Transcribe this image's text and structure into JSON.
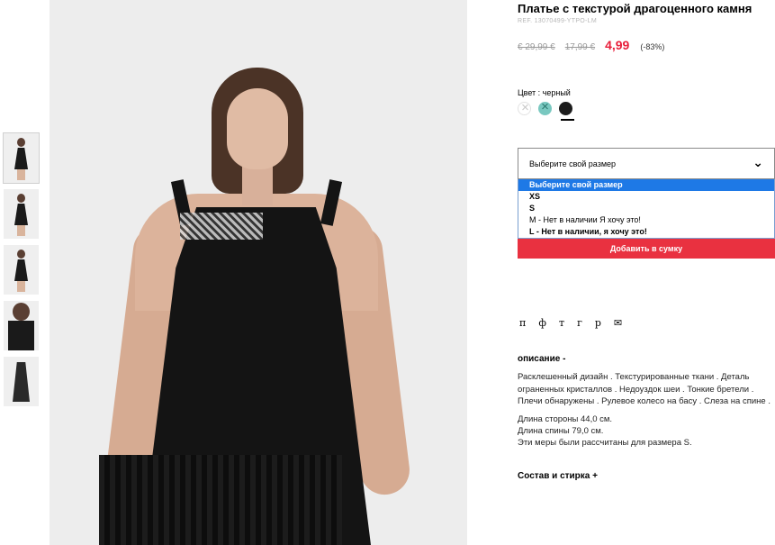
{
  "product": {
    "title": "Платье с текстурой драгоценного камня",
    "ref": "REF. 13070499-YTPO-LM",
    "price_original": "€ 29,99 €",
    "price_previous": "17,99 €",
    "price_current": "4,99",
    "discount": "(-83%)"
  },
  "color": {
    "label": "Цвет : черный",
    "swatches": [
      {
        "name": "white",
        "hex": "#ffffff",
        "available": false
      },
      {
        "name": "teal",
        "hex": "#79c8c0",
        "available": false
      },
      {
        "name": "black",
        "hex": "#1c1c1c",
        "available": true,
        "selected": true
      }
    ]
  },
  "size": {
    "placeholder": "Выберите свой размер",
    "options": [
      "Выберите свой размер",
      "XS",
      "S",
      "M - Нет в наличии Я хочу это!",
      "L - Нет в наличии, я хочу это!"
    ]
  },
  "add_to_bag": "Добавить в сумку",
  "share": [
    "п",
    "ф",
    "т",
    "г",
    "р",
    "✉"
  ],
  "description": {
    "heading": "описание -",
    "text": "Расклешенный дизайн . Текстурированные ткани . Деталь ограненных кристаллов . Недоуздок шеи . Тонкие бретели . Плечи обнаружены . Рулевое колесо на басу . Слеза на спине .",
    "side_length": "Длина стороны 44,0 см.",
    "back_length": "Длина спины 79,0 см.",
    "measured_note": "Эти меры были рассчитаны для размера S."
  },
  "composition": "Состав и стирка +",
  "colors": {
    "accent": "#e93140",
    "price": "#e81e3a",
    "select_highlight": "#1e79e6"
  }
}
